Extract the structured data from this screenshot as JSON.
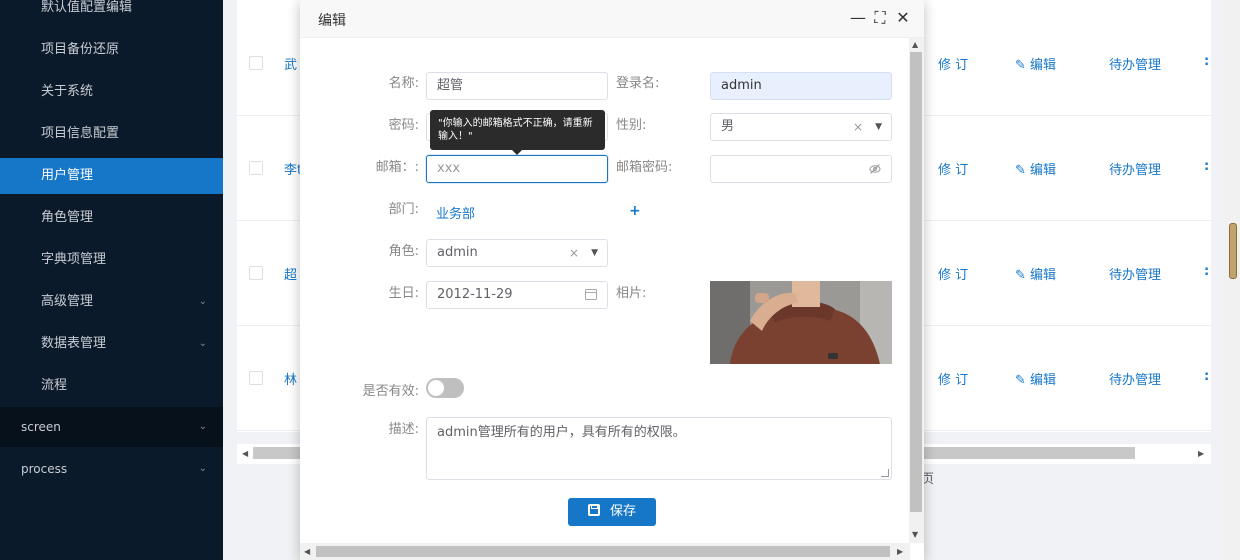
{
  "sidebar": {
    "items": [
      {
        "label": "默认值配置编辑"
      },
      {
        "label": "项目备份还原"
      },
      {
        "label": "关于系统"
      },
      {
        "label": "项目信息配置"
      },
      {
        "label": "用户管理",
        "active": true
      },
      {
        "label": "角色管理"
      },
      {
        "label": "字典项管理"
      },
      {
        "label": "高级管理",
        "expandable": true
      },
      {
        "label": "数据表管理",
        "expandable": true
      },
      {
        "label": "流程"
      }
    ],
    "groups": [
      {
        "label": "screen"
      },
      {
        "label": "process"
      }
    ],
    "chevron": "⌄"
  },
  "table": {
    "rows": [
      {
        "name": "武"
      },
      {
        "name": "李t"
      },
      {
        "name": "超"
      },
      {
        "name": "林"
      }
    ],
    "actions": {
      "revise": "修 订",
      "edit": "编辑",
      "todo": "待办管理",
      "more": ":"
    },
    "pager_tail": "页"
  },
  "dialog": {
    "title": "编辑",
    "controls": {
      "minimize": "—",
      "maximize": "⛶",
      "close": "✕"
    },
    "form": {
      "name": {
        "label": "名称:",
        "value": "超管"
      },
      "login": {
        "label": "登录名:",
        "value": "admin"
      },
      "password": {
        "label": "密码:",
        "value": ""
      },
      "gender": {
        "label": "性别:",
        "value": "男"
      },
      "email": {
        "label": "邮箱：:",
        "value": "xxx"
      },
      "email_password": {
        "label": "邮箱密码:",
        "value": ""
      },
      "department": {
        "label": "部门:",
        "value": "业务部",
        "add": "+"
      },
      "role": {
        "label": "角色:",
        "value": "admin"
      },
      "birthday": {
        "label": "生日:",
        "value": "2012-11-29"
      },
      "photo": {
        "label": "相片:"
      },
      "enabled": {
        "label": "是否有效:",
        "on": false
      },
      "description": {
        "label": "描述:",
        "value": "admin管理所有的用户，具有所有的权限。"
      }
    },
    "tooltip": "\"你输入的邮箱格式不正确，请重新输入！\"",
    "clear_glyph": "×",
    "caret_glyph": "▼",
    "save_label": "保存"
  },
  "colors": {
    "accent": "#1677c9",
    "sidebar_bg": "#0b1a2b",
    "tooltip_bg": "#2b2b2b"
  }
}
